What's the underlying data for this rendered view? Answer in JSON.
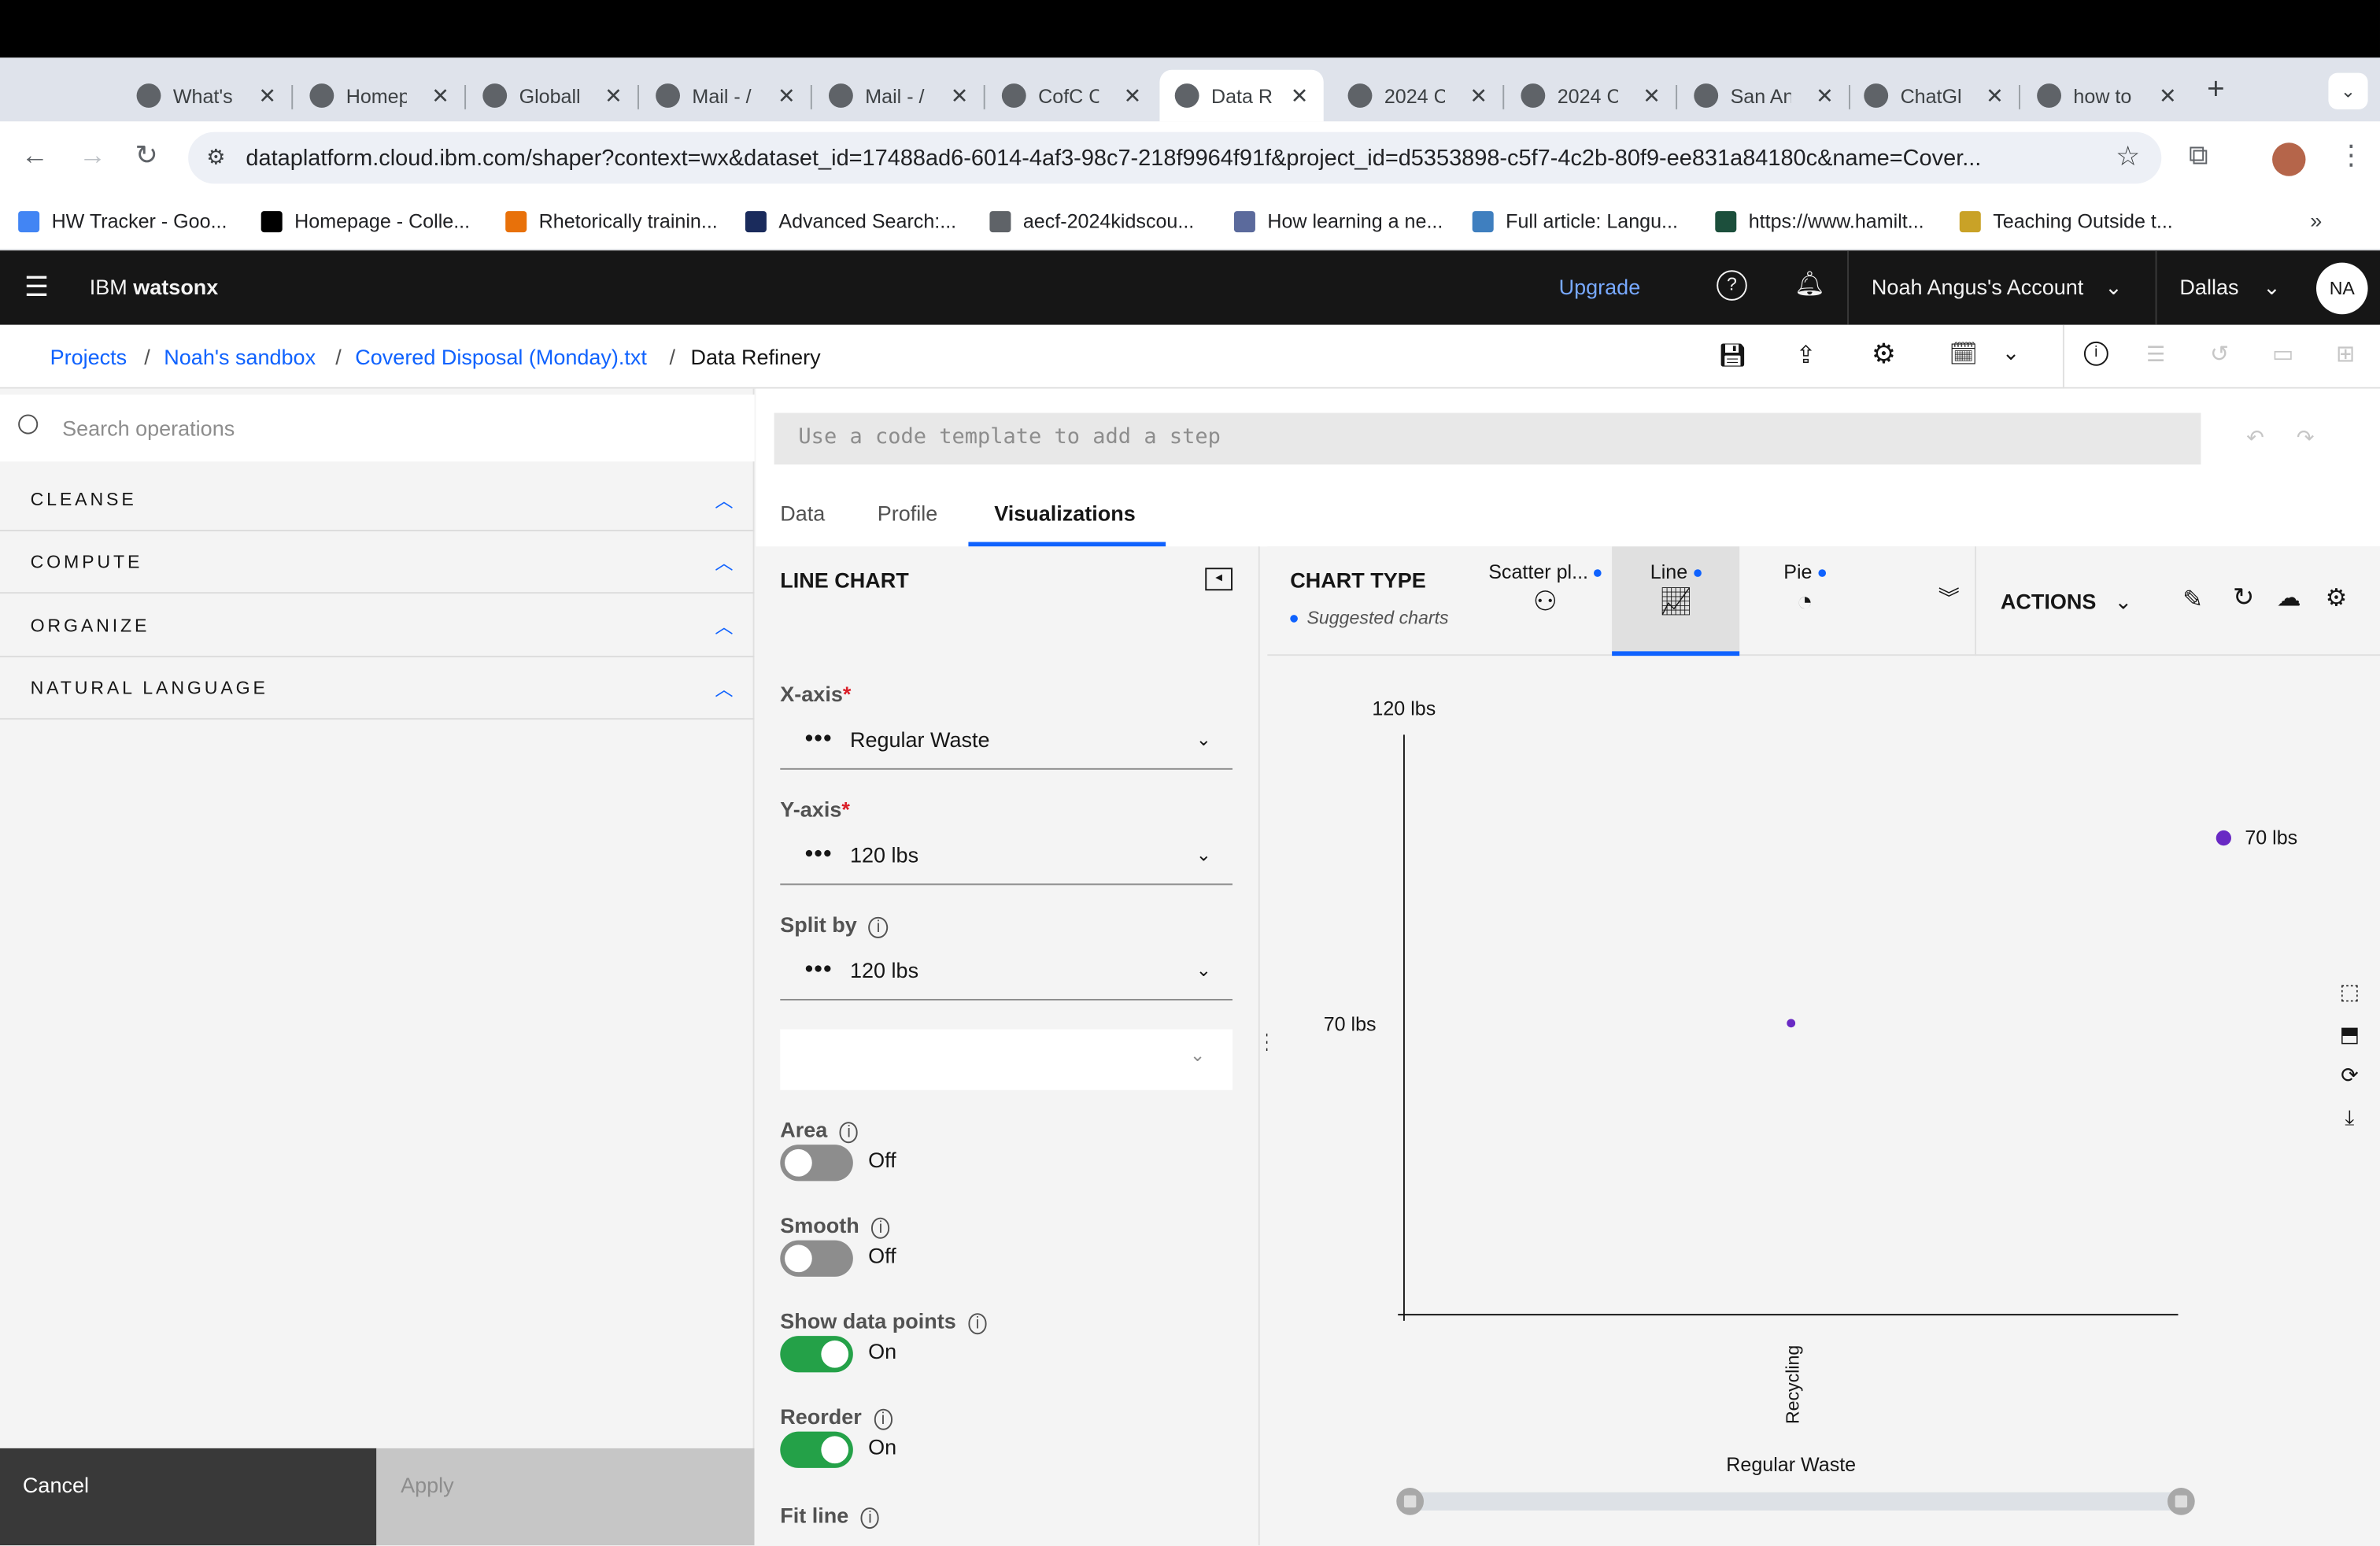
{
  "browser": {
    "tabs": [
      {
        "title": "What's",
        "favicon": "chrome-icon"
      },
      {
        "title": "Homep",
        "favicon": "d2l-icon"
      },
      {
        "title": "Globall",
        "favicon": "globe-icon"
      },
      {
        "title": "Mail - /",
        "favicon": "outlook-icon"
      },
      {
        "title": "Mail - /",
        "favicon": "outlook-icon"
      },
      {
        "title": "CofC C",
        "favicon": "docs-icon"
      },
      {
        "title": "Data R",
        "favicon": "watsonx-icon"
      },
      {
        "title": "2024 C",
        "favicon": "globe-icon"
      },
      {
        "title": "2024 C",
        "favicon": "globe-icon"
      },
      {
        "title": "San An",
        "favicon": "nba-icon"
      },
      {
        "title": "ChatGl",
        "favicon": "chatgpt-icon"
      },
      {
        "title": "how to",
        "favicon": "google-icon"
      }
    ],
    "active_tab_index": 6,
    "new_tab": "+",
    "url": "dataplatform.cloud.ibm.com/shaper?context=wx&dataset_id=17488ad6-6014-4af3-98c7-218f9964f91f&project_id=d5353898-c5f7-4c2b-80f9-ee831a84180c&name=Cover...",
    "bookmarks": [
      {
        "label": "HW Tracker - Goo...",
        "icon": "docs-icon",
        "color": "#4285f4"
      },
      {
        "label": "Homepage - Colle...",
        "icon": "d2l-icon",
        "color": "#000000"
      },
      {
        "label": "Rhetorically trainin...",
        "icon": "e-icon",
        "color": "#e8710a"
      },
      {
        "label": "Advanced Search:...",
        "icon": "ebsco-icon",
        "color": "#1a2b5c"
      },
      {
        "label": "aecf-2024kidscou...",
        "icon": "globe-icon",
        "color": "#5f6368"
      },
      {
        "label": "How learning a ne...",
        "icon": "shield-icon",
        "color": "#5b6a9c"
      },
      {
        "label": "Full article: Langu...",
        "icon": "tf-icon",
        "color": "#3f7fbf"
      },
      {
        "label": "https://www.hamilt...",
        "icon": "h-icon",
        "color": "#1c4f3c"
      },
      {
        "label": "Teaching Outside t...",
        "icon": "v-icon",
        "color": "#c9a227"
      }
    ]
  },
  "header": {
    "brand_prefix": "IBM",
    "brand_name": "watsonx",
    "upgrade": "Upgrade",
    "account": "Noah Angus's Account",
    "region": "Dallas",
    "avatar": "NA"
  },
  "breadcrumb": {
    "items": [
      "Projects",
      "Noah's sandbox",
      "Covered Disposal (Monday).txt"
    ],
    "current": "Data Refinery",
    "sep": "/"
  },
  "left": {
    "search_placeholder": "Search operations",
    "sections": [
      "CLEANSE",
      "COMPUTE",
      "ORGANIZE",
      "NATURAL LANGUAGE"
    ],
    "cancel": "Cancel",
    "apply": "Apply"
  },
  "code_placeholder": "Use a code template to add a step",
  "view_tabs": {
    "data": "Data",
    "profile": "Profile",
    "visualizations": "Visualizations"
  },
  "config": {
    "title": "LINE CHART",
    "x_label": "X-axis",
    "x_value": "Regular Waste",
    "y_label": "Y-axis",
    "y_value": "120 lbs",
    "split_label": "Split by",
    "split_value": "120 lbs",
    "required": "*",
    "toggles": [
      {
        "label": "Area",
        "state": "Off",
        "on": false
      },
      {
        "label": "Smooth",
        "state": "Off",
        "on": false
      },
      {
        "label": "Show data points",
        "state": "On",
        "on": true
      },
      {
        "label": "Reorder",
        "state": "On",
        "on": true
      }
    ],
    "fit_line": "Fit line"
  },
  "chart_types": {
    "label": "CHART TYPE",
    "suggested": "Suggested charts",
    "types": [
      "Scatter pl...",
      "Line",
      "Pie"
    ],
    "selected": "Line",
    "actions": "ACTIONS"
  },
  "colors": {
    "accent": "#0f62fe",
    "toggle_on": "#24a148",
    "series": "#6929c4"
  },
  "chart_data": {
    "type": "line",
    "title": "",
    "ylabel": "",
    "xlabel": "Regular Waste",
    "y_ticks": [
      "120 lbs",
      "70 lbs"
    ],
    "x": [
      "Recycling"
    ],
    "series": [
      {
        "name": "70 lbs",
        "values": [
          70
        ]
      }
    ],
    "ylim": [
      0,
      120
    ],
    "legend_position": "right",
    "grid": false
  }
}
